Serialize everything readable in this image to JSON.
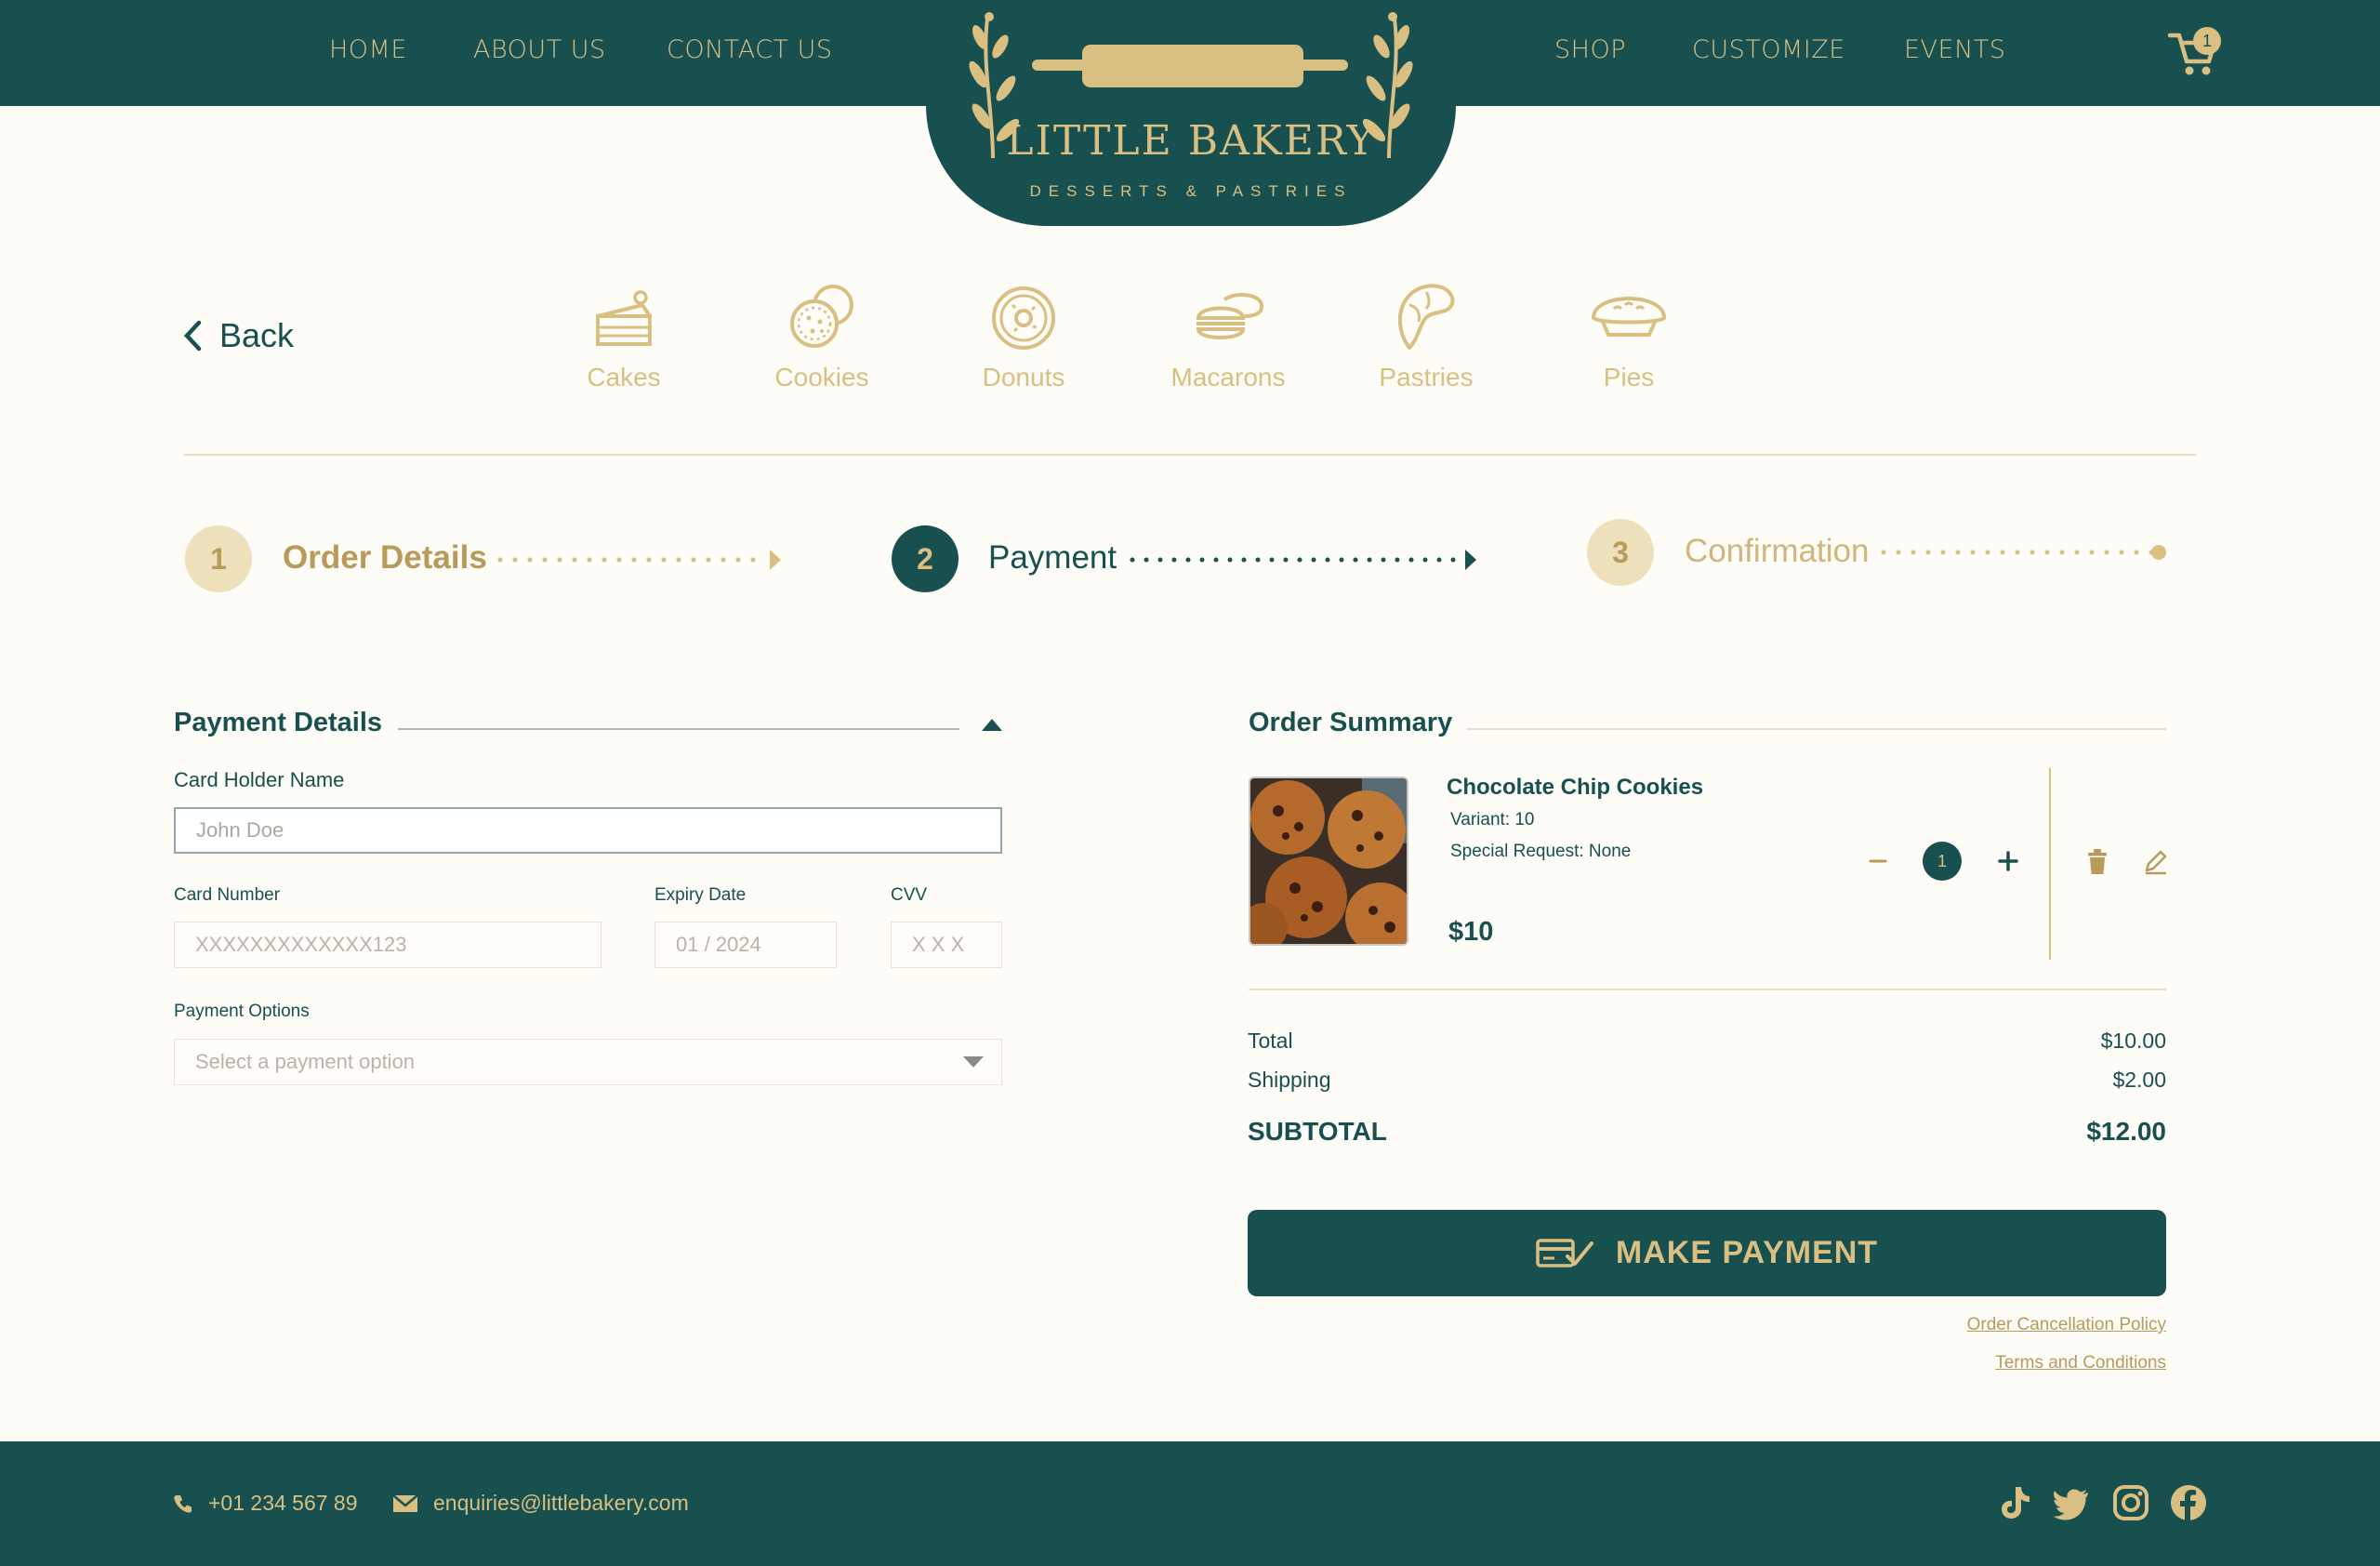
{
  "nav": {
    "left": [
      "HOME",
      "ABOUT US",
      "CONTACT US"
    ],
    "right": [
      "SHOP",
      "CUSTOMIZE",
      "EVENTS"
    ],
    "cart_count": "1"
  },
  "logo": {
    "title": "LITTLE BAKERY",
    "subtitle": "DESSERTS & PASTRIES"
  },
  "back_label": "Back",
  "categories": [
    {
      "label": "Cakes",
      "icon": "cake-icon"
    },
    {
      "label": "Cookies",
      "icon": "cookie-icon"
    },
    {
      "label": "Donuts",
      "icon": "donut-icon"
    },
    {
      "label": "Macarons",
      "icon": "macaron-icon"
    },
    {
      "label": "Pastries",
      "icon": "croissant-icon"
    },
    {
      "label": "Pies",
      "icon": "pie-icon"
    }
  ],
  "steps": [
    {
      "number": "1",
      "label": "Order Details",
      "state": "done"
    },
    {
      "number": "2",
      "label": "Payment",
      "state": "active"
    },
    {
      "number": "3",
      "label": "Confirmation",
      "state": "upcoming"
    }
  ],
  "payment": {
    "title": "Payment Details",
    "card_holder_label": "Card Holder Name",
    "card_holder_placeholder": "John Doe",
    "card_number_label": "Card Number",
    "card_number_placeholder": "XXXXXXXXXXXXX123",
    "expiry_label": "Expiry Date",
    "expiry_placeholder": "01 / 2024",
    "cvv_label": "CVV",
    "cvv_placeholder": "X X X",
    "options_label": "Payment Options",
    "options_placeholder": "Select a payment option"
  },
  "summary": {
    "title": "Order Summary",
    "item": {
      "name": "Chocolate Chip Cookies",
      "variant": "Variant: 10",
      "special_request": "Special Request: None",
      "price": "$10",
      "quantity": "1"
    },
    "total_label": "Total",
    "total_value": "$10.00",
    "shipping_label": "Shipping",
    "shipping_value": "$2.00",
    "subtotal_label": "SUBTOTAL",
    "subtotal_value": "$12.00",
    "pay_button": "MAKE PAYMENT",
    "cancellation_link": "Order Cancellation Policy",
    "terms_link": "Terms and Conditions"
  },
  "footer": {
    "phone": "+01 234 567 89",
    "email": "enquiries@littlebakery.com",
    "socials": [
      "tiktok-icon",
      "twitter-icon",
      "instagram-icon",
      "facebook-icon"
    ]
  },
  "colors": {
    "teal": "#17504f",
    "gold": "#d9bf82",
    "background": "#fdfcf7"
  }
}
